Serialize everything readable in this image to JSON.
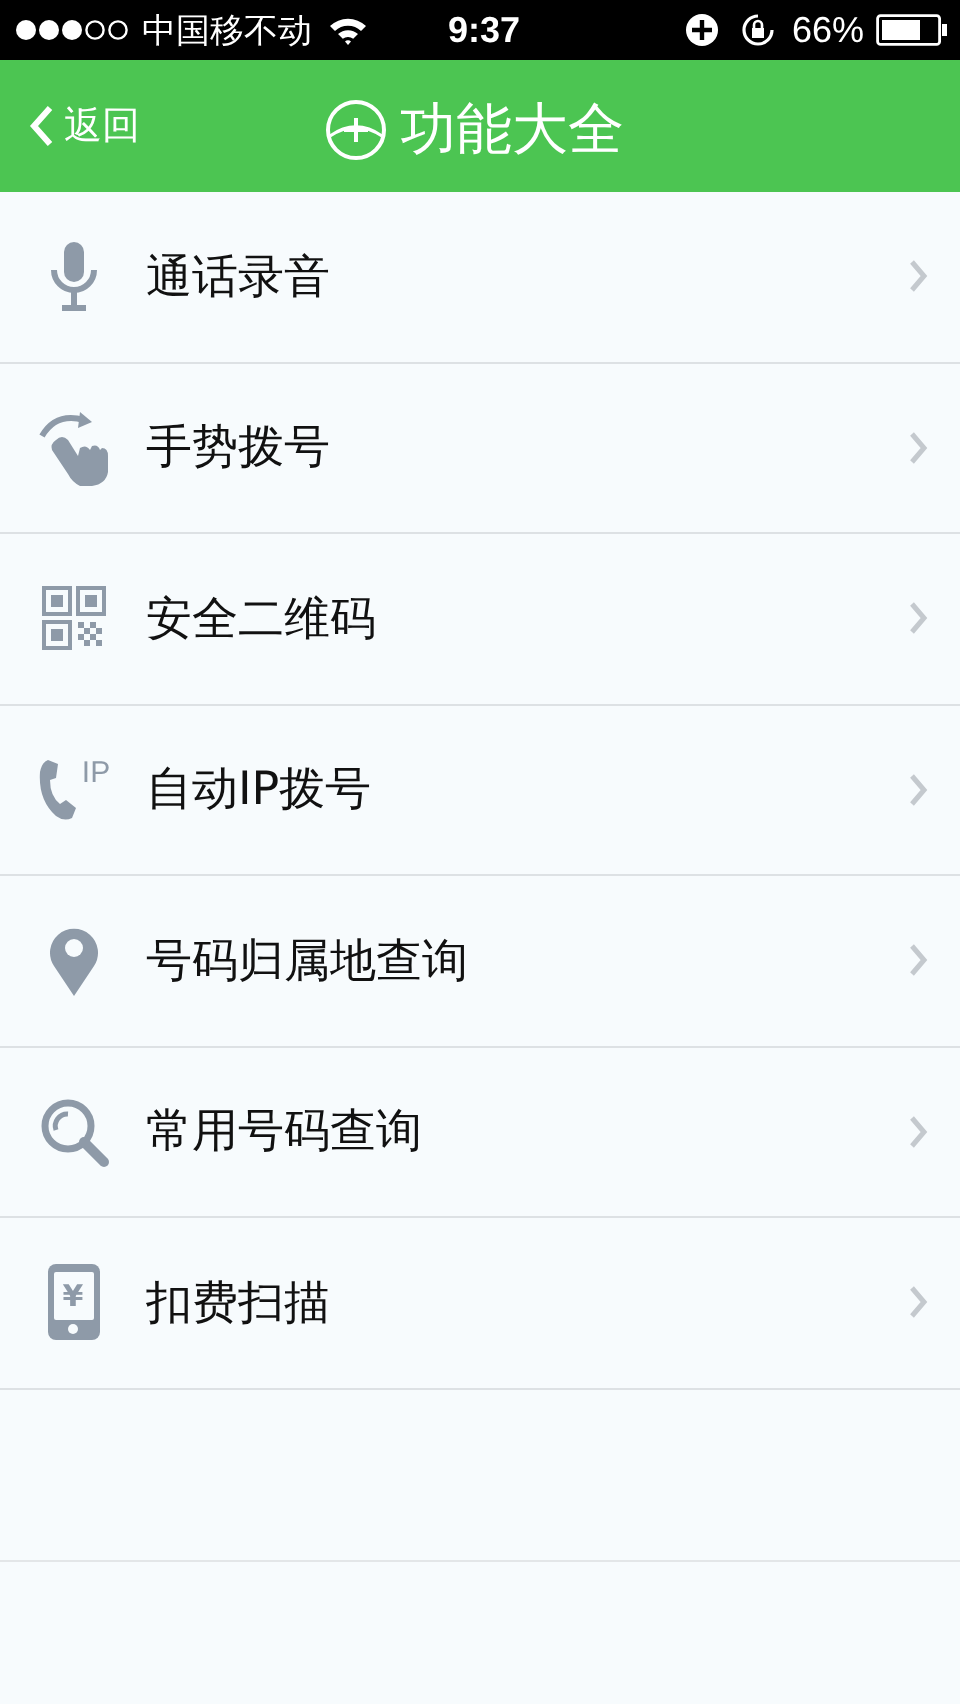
{
  "status_bar": {
    "carrier": "中国移不动",
    "time": "9:37",
    "battery_percent": "66%"
  },
  "header": {
    "back_label": "返回",
    "title": "功能大全"
  },
  "items": [
    {
      "kind": "mic",
      "label": "通话录音"
    },
    {
      "kind": "gesture",
      "label": "手势拨号"
    },
    {
      "kind": "qr",
      "label": "安全二维码"
    },
    {
      "kind": "phone",
      "label": "自动IP拨号",
      "icon_text": "IP"
    },
    {
      "kind": "pin",
      "label": "号码归属地查询"
    },
    {
      "kind": "search",
      "label": "常用号码查询"
    },
    {
      "kind": "device",
      "label": "扣费扫描",
      "icon_text": "¥"
    }
  ]
}
